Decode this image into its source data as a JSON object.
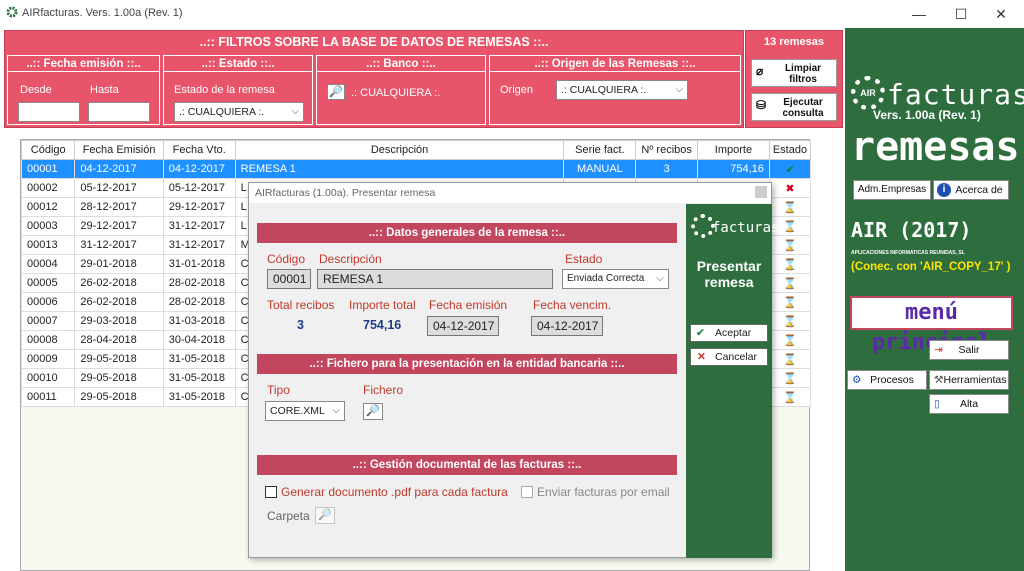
{
  "window": {
    "title": "AIRfacturas. Vers. 1.00a (Rev. 1)",
    "min": "—",
    "max": "☐",
    "close": "✕"
  },
  "filters": {
    "header": "..::  FILTROS SOBRE LA BASE DE DATOS DE REMESAS  ::..",
    "fecha": {
      "title": "..:: Fecha emisión ::..",
      "desde": "Desde",
      "hasta": "Hasta"
    },
    "estado": {
      "title": "..:: Estado ::..",
      "label": "Estado de la remesa",
      "value": ".: CUALQUIERA :."
    },
    "banco": {
      "title": "..:: Banco ::..",
      "value": ".: CUALQUIERA :."
    },
    "origen": {
      "title": "..:: Origen de las Remesas ::..",
      "label": "Origen",
      "value": ".: CUALQUIERA :."
    }
  },
  "count": "13 remesas",
  "buttons": {
    "limpiar": "Limpiar filtros",
    "ejecutar": "Ejecutar consulta"
  },
  "right": {
    "logo": "facturas",
    "logo_small": "AIR",
    "version": "Vers. 1.00a (Rev. 1)",
    "module": "remesas",
    "adm": "Adm.Empresas",
    "acerca": "Acerca de",
    "company": "AIR (2017)",
    "company_sub": "APLICACIONES INFORMATICAS REUNIDAS, SL",
    "conn": "(Conec. con 'AIR_COPY_17' )",
    "menu": "menú principal",
    "salir": "Salir",
    "procesos": "Procesos",
    "herramientas": "Herramientas",
    "alta": "Alta"
  },
  "table": {
    "headers": [
      "Código",
      "Fecha Emisión",
      "Fecha Vto.",
      "Descripción",
      "Serie fact.",
      "Nº recibos",
      "Importe",
      "Estado"
    ],
    "rows": [
      [
        "00001",
        "04-12-2017",
        "04-12-2017",
        "REMESA 1",
        "MANUAL",
        "3",
        "754,16",
        "✔"
      ],
      [
        "00002",
        "05-12-2017",
        "05-12-2017",
        "L",
        "",
        "",
        "",
        "✖"
      ],
      [
        "00012",
        "28-12-2017",
        "29-12-2017",
        "L",
        "",
        "",
        "",
        "⌛"
      ],
      [
        "00003",
        "29-12-2017",
        "31-12-2017",
        "L",
        "",
        "",
        "",
        "⌛"
      ],
      [
        "00013",
        "31-12-2017",
        "31-12-2017",
        "M",
        "",
        "",
        "",
        "⌛"
      ],
      [
        "00004",
        "29-01-2018",
        "31-01-2018",
        "C",
        "",
        "",
        "",
        "⌛"
      ],
      [
        "00005",
        "26-02-2018",
        "28-02-2018",
        "C",
        "",
        "",
        "",
        "⌛"
      ],
      [
        "00006",
        "26-02-2018",
        "28-02-2018",
        "C",
        "",
        "",
        "",
        "⌛"
      ],
      [
        "00007",
        "29-03-2018",
        "31-03-2018",
        "C",
        "",
        "",
        "",
        "⌛"
      ],
      [
        "00008",
        "28-04-2018",
        "30-04-2018",
        "C",
        "",
        "",
        "",
        "⌛"
      ],
      [
        "00009",
        "29-05-2018",
        "31-05-2018",
        "C",
        "",
        "",
        "",
        "⌛"
      ],
      [
        "00010",
        "29-05-2018",
        "31-05-2018",
        "C",
        "",
        "",
        "",
        "⌛"
      ],
      [
        "00011",
        "29-05-2018",
        "31-05-2018",
        "C",
        "",
        "",
        "",
        "⌛"
      ]
    ]
  },
  "dialog": {
    "title": "AIRfacturas (1.00a). Presentar remesa",
    "s1": "..:: Datos generales de la remesa ::..",
    "codigo_l": "Código",
    "codigo": "00001",
    "desc_l": "Descripción",
    "desc": "REMESA 1",
    "estado_l": "Estado",
    "estado": "Enviada Correcta",
    "total_l": "Total recibos",
    "total": "3",
    "importe_l": "Importe total",
    "importe": "754,16",
    "femi_l": "Fecha emisión",
    "femi": "04-12-2017",
    "fven_l": "Fecha vencim.",
    "fven": "04-12-2017",
    "s2": "..:: Fichero para la presentación en la entidad bancaria ::..",
    "tipo_l": "Tipo",
    "tipo": "CORE.XML",
    "fichero_l": "Fichero",
    "s3": "..:: Gestión documental de las facturas ::..",
    "gen_pdf": "Generar documento .pdf para cada factura",
    "email": "Enviar facturas por email",
    "carpeta": "Carpeta",
    "side_logo": "facturas",
    "side_title": "Presentar remesa",
    "aceptar": "Aceptar",
    "cancelar": "Cancelar"
  },
  "colors": {
    "filter_red": "#e8546a",
    "section_red": "#c2475e",
    "green": "#2e6e3e",
    "select_blue": "#1e90ff"
  }
}
